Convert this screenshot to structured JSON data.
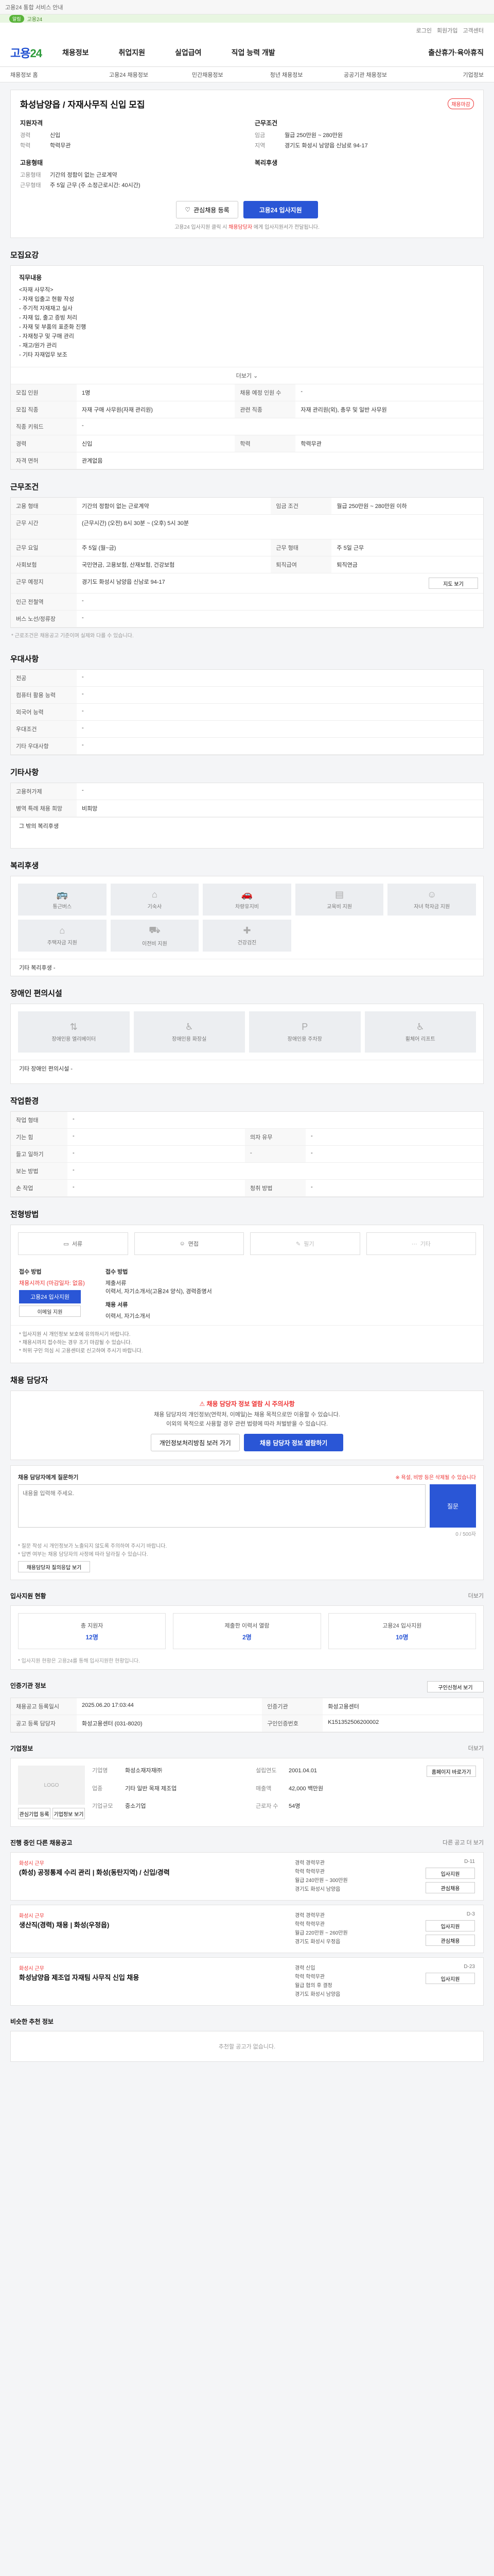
{
  "topbar": {
    "text": "고용24 통합 서비스 안내"
  },
  "greenbar": {
    "pill": "알림",
    "text": "고용24"
  },
  "util": [
    "로그인",
    "회원가입",
    "고객센터"
  ],
  "gnb": {
    "logo_a": "고용",
    "logo_b": "24",
    "menu": [
      "채용정보",
      "취업지원",
      "실업급여",
      "직업 능력 개발",
      "출산휴가·육아휴직"
    ]
  },
  "subnav": [
    "채용정보 홈",
    "고용24 채용정보",
    "민간채용정보",
    "청년 채용정보",
    "공공기관 채용정보",
    "기업정보"
  ],
  "job": {
    "title": "화성남양읍 / 자재사무직 신입 모집",
    "badge": "채용마감",
    "left_label": "지원자격",
    "left": [
      {
        "k": "경력",
        "v": "신입"
      },
      {
        "k": "학력",
        "v": "학력무관"
      }
    ],
    "right_label": "근무조건",
    "right": [
      {
        "k": "임금",
        "v": "월급 250만원 ~ 280만원"
      },
      {
        "k": "지역",
        "v": "경기도 화성시 남양읍 신남로 94-17"
      }
    ],
    "emp_label": "고용형태",
    "emp": [
      {
        "k": "고용형태",
        "v": "기간의 정함이 없는 근로계약"
      },
      {
        "k": "근무형태",
        "v": "주 5일 근무 (주 소정근로시간: 40시간)"
      }
    ],
    "welfare_label": "복리후생",
    "btn_bookmark": "관심채용 등록",
    "btn_apply": "고용24 입사지원",
    "note_a": "고용24 입사지원 클릭 시 ",
    "note_b": "채용담당자",
    "note_c": " 에게 입사지원서가 전달됩니다."
  },
  "sections": {
    "recruit": "모집요강",
    "work": "근무조건",
    "pref": "우대사항",
    "etc": "기타사항",
    "welfare": "복리후생",
    "disabled": "장애인 편의시설",
    "env": "작업환경",
    "process": "전형방법",
    "contact": "채용 담당자",
    "apply_status": "입사지원 현황",
    "info": "인증기관 정보",
    "company": "기업정보",
    "related": "진행 중인 다른 채용공고",
    "similar": "비슷한 추천 정보"
  },
  "recruit": {
    "duty_head": "직무내용",
    "duty_lines": [
      "<자재 사무직>",
      "- 자재 입출고 현황 작성",
      "- 주기적 자재재고 실사",
      "- 자재 입, 출고 증빙 처리",
      "- 자재 및 부품의 표준화 진행",
      "- 자재청구 및 구매 관리",
      "- 재고/원가 관리",
      "- 기타 자재업무 보조"
    ],
    "more": "더보기",
    "rows": [
      {
        "k": "모집 인원",
        "v": "1명",
        "k2": "채용 예정 인원 수",
        "v2": "-"
      },
      {
        "k": "모집 직종",
        "v": "자재 구매 사무원(자재 관리원)",
        "k2": "관련 직종",
        "v2": "자재 관리원(외), 총무 및 일반 사무원"
      },
      {
        "k": "직종 키워드",
        "v": "-",
        "k2": "",
        "v2": ""
      },
      {
        "k": "경력",
        "v": "신입",
        "k2": "학력",
        "v2": "학력무관"
      },
      {
        "k": "자격 면허",
        "v": "관계없음",
        "k2": "",
        "v2": ""
      }
    ]
  },
  "work": {
    "rows": [
      {
        "k": "고용 형태",
        "v": "기간의 정함이 없는 근로계약",
        "k2": "임금 조건",
        "v2": "월급 250만원 ~ 280만원 이하"
      },
      {
        "k": "근무 시간",
        "v": "(근무시간) (오전) 8시 30분 ~ (오후) 5시 30분",
        "k2": "",
        "v2": ""
      },
      {
        "k": "근무 요일",
        "v": "주 5일 (월~금)",
        "k2": "근무 형태",
        "v2": "주 5일 근무"
      },
      {
        "k": "사회보험",
        "v": "국민연금, 고용보험, 산재보험, 건강보험",
        "k2": "퇴직급여",
        "v2": "퇴직연금"
      },
      {
        "k": "근무 예정지",
        "v": "경기도 화성시 남양읍 신남로 94-17",
        "k2": "",
        "v2": ""
      },
      {
        "k": "인근 전철역",
        "v": "-",
        "k2": "",
        "v2": ""
      },
      {
        "k": "버스 노선/정류장",
        "v": "-",
        "k2": "",
        "v2": ""
      }
    ],
    "map_btn": "지도 보기",
    "note": "* 근로조건은 채용공고 기준이며 실제와 다를 수 있습니다."
  },
  "pref": {
    "rows": [
      {
        "k": "전공",
        "v": "-"
      },
      {
        "k": "컴퓨터 활용 능력",
        "v": "-"
      },
      {
        "k": "외국어 능력",
        "v": "-"
      },
      {
        "k": "우대조건",
        "v": "-"
      },
      {
        "k": "기타 우대사항",
        "v": "-"
      }
    ]
  },
  "etc": {
    "rows": [
      {
        "k": "고용허가제",
        "v": "-"
      },
      {
        "k": "병역 특례 채용 희망",
        "v": "비희망"
      }
    ],
    "extra": "그 밖의 복리후생"
  },
  "welfare": {
    "tiles": [
      "통근버스",
      "기숙사",
      "차량유지비",
      "교육비 지원",
      "자녀 학자금 지원",
      "주택자금 지원",
      "이전비 지원",
      "건강검진"
    ],
    "extra_label": "기타 복리후생",
    "extra_value": "-"
  },
  "disabled": {
    "tiles": [
      "장애인용 엘리베이터",
      "장애인용 화장실",
      "장애인용 주차장",
      "휠체어 리프트"
    ],
    "extra_label": "기타 장애인 편의시설",
    "extra_value": "-"
  },
  "env": {
    "rows": [
      {
        "k": "작업 형태",
        "v": "-",
        "k2": "",
        "v2": ""
      },
      {
        "k": "기는 힘",
        "v": "-",
        "k2": "의자 유무",
        "v2": "-"
      },
      {
        "k": "들고 일하기",
        "v": "-",
        "k2": "-",
        "v2": "-"
      },
      {
        "k": "보는 방법",
        "v": "-",
        "k2": "",
        "v2": ""
      },
      {
        "k": "손 작업",
        "v": "-",
        "k2": "청취 방법",
        "v2": "-"
      }
    ]
  },
  "process": {
    "steps": [
      "서류",
      "면접",
      "필기",
      "기타"
    ],
    "apply_method_label": "접수 방법",
    "apply_deadline_label": "채용시까지 (마감일자: 없음)",
    "apply_btn": "고용24 입사지원",
    "apply_btn2": "이메일 지원",
    "docs_label": "접수 방법",
    "docs_lines": [
      "제출서류",
      "이력서, 자기소개서(고용24 양식), 경력증명서"
    ],
    "method_label": "채용 서류",
    "method_value": "이력서, 자기소개서",
    "notes": [
      "* 입사지원 시 개인정보 보호에 유의하시기 바랍니다.",
      "* 채용시까지 접수하는 경우 조기 마감될 수 있습니다.",
      "* 허위 구인 의심 시 고용센터로 신고하여 주시기 바랍니다."
    ]
  },
  "contact": {
    "warn": "채용 담당자 정보 열람 시 주의사항",
    "lines": [
      "채용 담당자의 개인정보(연락처, 이메일)는 채용 목적으로만 이용할 수 있습니다.",
      "이외의 목적으로 사용할 경우 관련 법령에 따라 처벌받을 수 있습니다."
    ],
    "btn_a": "개인정보처리방침 보러 가기",
    "btn_b": "채용 담당자 정보 열람하기",
    "qa_label": "채용 담당자에게 질문하기",
    "qa_notice": "※ 욕설, 비방 등은 삭제될 수 있습니다",
    "qa_placeholder": "내용을 입력해 주세요.",
    "qa_count": "0 / 500자",
    "qa_submit": "질문",
    "qa_notes": [
      "* 질문 작성 시 개인정보가 노출되지 않도록 주의하여 주시기 바랍니다.",
      "* 답변 여부는 채용 담당자의 사정에 따라 달라질 수 있습니다."
    ],
    "qa_more": "채용담당자 질의응답 보기"
  },
  "apply_status": {
    "more": "더보기",
    "stats": [
      {
        "label": "총 지원자",
        "value": "12명"
      },
      {
        "label": "제출한 이력서 열람",
        "value": "2명"
      },
      {
        "label": "고용24 입사지원",
        "value": "10명"
      }
    ],
    "note": "* 입사지원 현황은 고용24를 통해 입사지원한 현황입니다."
  },
  "info": {
    "print_btn": "구인신청서 보기",
    "rows": [
      {
        "k": "채용공고 등록일시",
        "v": "2025.06.20 17:03:44",
        "k2": "인증기관",
        "v2": "화성고용센터"
      },
      {
        "k": "공고 등록 담당자",
        "v": "화성고용센터 (031-8020)",
        "k2": "구인인증번호",
        "v2": "K151352506200002"
      }
    ]
  },
  "company": {
    "more": "더보기",
    "logo": "LOGO",
    "info": [
      {
        "k": "기업명",
        "v": "화성소재자재㈜"
      },
      {
        "k": "설립연도",
        "v": "2001.04.01"
      },
      {
        "k": "업종",
        "v": "기타 일반 목재 제조업"
      },
      {
        "k": "매출액",
        "v": "42,000 백만원"
      },
      {
        "k": "기업규모",
        "v": "중소기업"
      },
      {
        "k": "근로자 수",
        "v": "54명"
      }
    ],
    "btns": [
      "관심기업 등록",
      "기업정보 보기"
    ],
    "btn_small": "홈페이지 바로가기"
  },
  "related": {
    "more": "다른 공고 더 보기",
    "items": [
      {
        "company": "화성시 근무",
        "title": "(화성) 공정통제 수리 관리 | 화성(동탄지역) / 신입/경력",
        "mid": [
          "경력 경력무관",
          "학력 학력무관",
          "월급 240만원 ~ 300만원",
          "경기도 화성시 남양읍"
        ],
        "dday": "D-11",
        "btns": [
          "입사지원",
          "관심채용"
        ]
      },
      {
        "company": "화성시 근무",
        "title": "생산직(경력) 채용 | 화성(우정읍)",
        "mid": [
          "경력 경력무관",
          "학력 학력무관",
          "월급 220만원 ~ 260만원",
          "경기도 화성시 우정읍"
        ],
        "dday": "D-3",
        "btns": [
          "입사지원",
          "관심채용"
        ]
      },
      {
        "company": "화성시 근무",
        "title": "화성남양읍 제조업 자재팀 사무직 신입 채용",
        "mid": [
          "경력 신입",
          "학력 학력무관",
          "월급 협의 후 결정",
          "경기도 화성시 남양읍"
        ],
        "dday": "D-23",
        "btns": [
          "입사지원"
        ]
      }
    ]
  },
  "similar": {
    "empty": "추천할 공고가 없습니다."
  }
}
